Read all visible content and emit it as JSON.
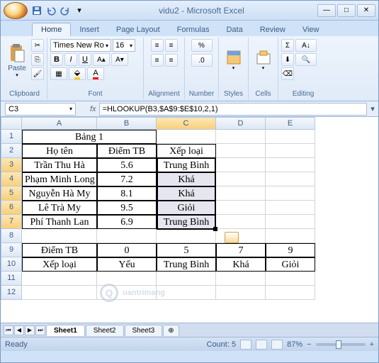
{
  "window": {
    "title": "vidu2 - Microsoft Excel"
  },
  "tabs": [
    "Home",
    "Insert",
    "Page Layout",
    "Formulas",
    "Data",
    "Review",
    "View"
  ],
  "active_tab": "Home",
  "ribbon": {
    "clipboard": {
      "paste": "Paste",
      "label": "Clipboard"
    },
    "font": {
      "name": "Times New Ro",
      "size": "16",
      "label": "Font"
    },
    "alignment": {
      "label": "Alignment"
    },
    "number": {
      "label": "Number",
      "percent": "%"
    },
    "styles": {
      "label": "Styles"
    },
    "cells": {
      "label": "Cells"
    },
    "editing": {
      "label": "Editing",
      "sigma": "Σ"
    }
  },
  "namebox": "C3",
  "formula": "=HLOOKUP(B3,$A$9:$E$10,2,1)",
  "columns": [
    "A",
    "B",
    "C",
    "D",
    "E"
  ],
  "rows": [
    "1",
    "2",
    "3",
    "4",
    "5",
    "6",
    "7",
    "8",
    "9",
    "10",
    "11",
    "12"
  ],
  "grid": {
    "r1": {
      "A": "Bảng 1"
    },
    "r2": {
      "A": "Họ tên",
      "B": "Điểm TB",
      "C": "Xếp loại"
    },
    "r3": {
      "A": "Trần Thu Hà",
      "B": "5.6",
      "C": "Trung Bình"
    },
    "r4": {
      "A": "Phạm Minh Long",
      "B": "7.2",
      "C": "Khá"
    },
    "r5": {
      "A": "Nguyễn Hà My",
      "B": "8.1",
      "C": "Khá"
    },
    "r6": {
      "A": "Lê Trà My",
      "B": "9.5",
      "C": "Giỏi"
    },
    "r7": {
      "A": "Phí Thanh Lan",
      "B": "6.9",
      "C": "Trung Bình"
    },
    "r9": {
      "A": "Điểm TB",
      "B": "0",
      "C": "5",
      "D": "7",
      "E": "9"
    },
    "r10": {
      "A": "Xếp loại",
      "B": "Yếu",
      "C": "Trung Bình",
      "D": "Khá",
      "E": "Giỏi"
    }
  },
  "sheets": [
    "Sheet1",
    "Sheet2",
    "Sheet3"
  ],
  "active_sheet": "Sheet1",
  "status": {
    "ready": "Ready",
    "count": "Count: 5",
    "zoom": "87%"
  },
  "watermark": "uantrimang"
}
